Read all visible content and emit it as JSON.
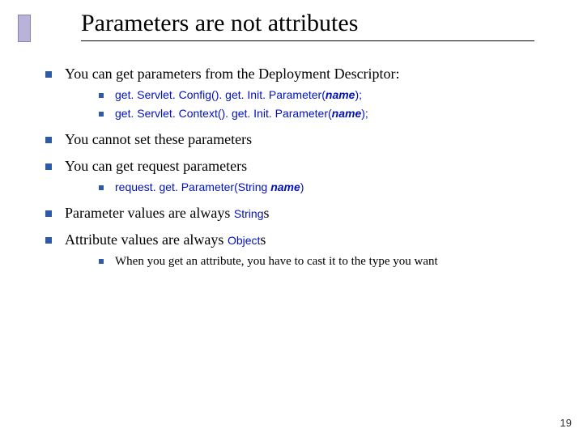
{
  "title": "Parameters are not attributes",
  "bullets": {
    "b1": "You can get parameters from the Deployment Descriptor:",
    "b1a_prefix": "get. Servlet. Config(). get. Init. Parameter(",
    "b1a_name": "name",
    "b1a_suffix": ");",
    "b1b_prefix": "get. Servlet. Context(). get. Init. Parameter(",
    "b1b_name": "name",
    "b1b_suffix": ");",
    "b2": "You cannot set these parameters",
    "b3": "You can get request parameters",
    "b3a_prefix": "request. get. Parameter(String ",
    "b3a_name": "name",
    "b3a_suffix": ")",
    "b4_pre": "Parameter values are always ",
    "b4_code": "String",
    "b4_post": "s",
    "b5_pre": "Attribute values are always ",
    "b5_code": "Object",
    "b5_post": "s",
    "b5a": "When you get an attribute, you have to cast it to the type you want"
  },
  "page_number": "19"
}
